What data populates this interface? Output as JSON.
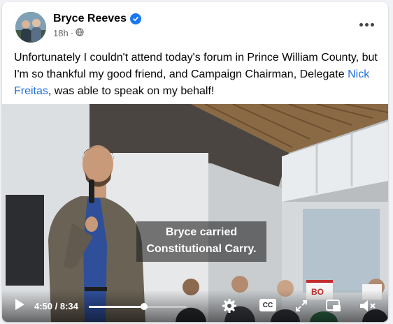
{
  "post": {
    "author": "Bryce Reeves",
    "time": "18h",
    "text_before": "Unfortunately I couldn't attend today's forum in Prince William County, but I'm so thankful my good friend, and Campaign Chairman, Delegate ",
    "link_text": "Nick Freitas",
    "text_after": ", was able to speak on my behalf!"
  },
  "video": {
    "caption_line1": "Bryce carried",
    "caption_line2": "Constitutional Carry.",
    "sign_text": "BO",
    "current_time": "4:50",
    "duration": "8:34",
    "time_display": "4:50 / 8:34",
    "progress": 0.564,
    "cc_label": "CC"
  },
  "colors": {
    "accent": "#1877f2",
    "link": "#216fdb"
  }
}
